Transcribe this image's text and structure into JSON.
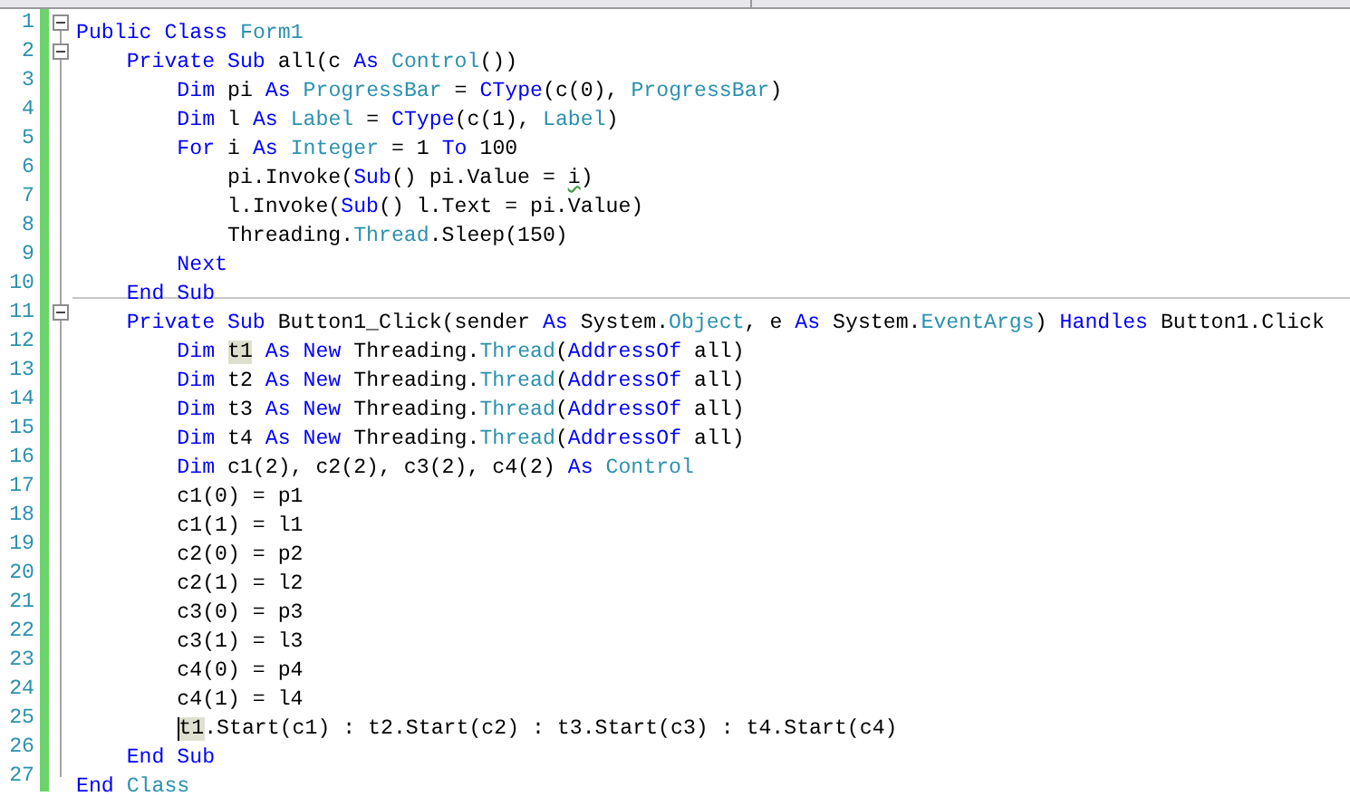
{
  "lines": [
    {
      "number": "1",
      "fold_toggle": {
        "expanded": true
      },
      "tokens": [
        {
          "kind": "keyword",
          "text": "Public"
        },
        {
          "kind": "keyword",
          "text": " Class"
        },
        {
          "kind": "type",
          "text": " Form1"
        }
      ]
    },
    {
      "number": "2",
      "fold_toggle": {
        "expanded": true
      },
      "tokens": [
        {
          "kind": "keyword",
          "text": "    Private Sub"
        },
        {
          "kind": "plain",
          "text": " all(c "
        },
        {
          "kind": "keyword",
          "text": "As"
        },
        {
          "kind": "type",
          "text": " Control"
        },
        {
          "kind": "plain",
          "text": "())"
        }
      ]
    },
    {
      "number": "3",
      "tokens": [
        {
          "kind": "keyword",
          "text": "        Dim"
        },
        {
          "kind": "plain",
          "text": " pi "
        },
        {
          "kind": "keyword",
          "text": "As"
        },
        {
          "kind": "type",
          "text": " ProgressBar"
        },
        {
          "kind": "plain",
          "text": " = "
        },
        {
          "kind": "keyword",
          "text": "CType"
        },
        {
          "kind": "plain",
          "text": "(c(0), "
        },
        {
          "kind": "type",
          "text": "ProgressBar"
        },
        {
          "kind": "plain",
          "text": ")"
        }
      ]
    },
    {
      "number": "4",
      "tokens": [
        {
          "kind": "keyword",
          "text": "        Dim"
        },
        {
          "kind": "plain",
          "text": " l "
        },
        {
          "kind": "keyword",
          "text": "As"
        },
        {
          "kind": "type",
          "text": " Label"
        },
        {
          "kind": "plain",
          "text": " = "
        },
        {
          "kind": "keyword",
          "text": "CType"
        },
        {
          "kind": "plain",
          "text": "(c(1), "
        },
        {
          "kind": "type",
          "text": "Label"
        },
        {
          "kind": "plain",
          "text": ")"
        }
      ]
    },
    {
      "number": "5",
      "tokens": [
        {
          "kind": "keyword",
          "text": "        For"
        },
        {
          "kind": "plain",
          "text": " i "
        },
        {
          "kind": "keyword",
          "text": "As"
        },
        {
          "kind": "type",
          "text": " Integer"
        },
        {
          "kind": "plain",
          "text": " = 1 "
        },
        {
          "kind": "keyword",
          "text": "To"
        },
        {
          "kind": "plain",
          "text": " 100"
        }
      ]
    },
    {
      "number": "6",
      "tokens": [
        {
          "kind": "plain",
          "text": "            pi.Invoke("
        },
        {
          "kind": "keyword",
          "text": "Sub"
        },
        {
          "kind": "plain",
          "text": "() pi.Value = "
        },
        {
          "kind": "warning",
          "text": "i"
        },
        {
          "kind": "plain",
          "text": ")"
        }
      ]
    },
    {
      "number": "7",
      "tokens": [
        {
          "kind": "plain",
          "text": "            l.Invoke("
        },
        {
          "kind": "keyword",
          "text": "Sub"
        },
        {
          "kind": "plain",
          "text": "() l.Text = pi.Value)"
        }
      ]
    },
    {
      "number": "8",
      "tokens": [
        {
          "kind": "plain",
          "text": "            Threading."
        },
        {
          "kind": "type",
          "text": "Thread"
        },
        {
          "kind": "plain",
          "text": ".Sleep(150)"
        }
      ]
    },
    {
      "number": "9",
      "tokens": [
        {
          "kind": "keyword",
          "text": "        Next"
        }
      ]
    },
    {
      "number": "10",
      "separator": true,
      "tokens": [
        {
          "kind": "keyword",
          "text": "    End Sub"
        }
      ]
    },
    {
      "number": "11",
      "fold_toggle": {
        "expanded": true
      },
      "tokens": [
        {
          "kind": "keyword",
          "text": "    Private Sub"
        },
        {
          "kind": "plain",
          "text": " Button1_Click(sender "
        },
        {
          "kind": "keyword",
          "text": "As"
        },
        {
          "kind": "plain",
          "text": " System."
        },
        {
          "kind": "type",
          "text": "Object"
        },
        {
          "kind": "plain",
          "text": ", e "
        },
        {
          "kind": "keyword",
          "text": "As"
        },
        {
          "kind": "plain",
          "text": " System."
        },
        {
          "kind": "type",
          "text": "EventArgs"
        },
        {
          "kind": "plain",
          "text": ") "
        },
        {
          "kind": "keyword",
          "text": "Handles"
        },
        {
          "kind": "plain",
          "text": " Button1.Click"
        }
      ]
    },
    {
      "number": "12",
      "tokens": [
        {
          "kind": "keyword",
          "text": "        Dim "
        },
        {
          "kind": "highlight",
          "text": "t1"
        },
        {
          "kind": "keyword",
          "text": " As New"
        },
        {
          "kind": "plain",
          "text": " Threading."
        },
        {
          "kind": "type",
          "text": "Thread"
        },
        {
          "kind": "plain",
          "text": "("
        },
        {
          "kind": "keyword",
          "text": "AddressOf"
        },
        {
          "kind": "plain",
          "text": " all)"
        }
      ]
    },
    {
      "number": "13",
      "tokens": [
        {
          "kind": "keyword",
          "text": "        Dim"
        },
        {
          "kind": "plain",
          "text": " t2 "
        },
        {
          "kind": "keyword",
          "text": "As New"
        },
        {
          "kind": "plain",
          "text": " Threading."
        },
        {
          "kind": "type",
          "text": "Thread"
        },
        {
          "kind": "plain",
          "text": "("
        },
        {
          "kind": "keyword",
          "text": "AddressOf"
        },
        {
          "kind": "plain",
          "text": " all)"
        }
      ]
    },
    {
      "number": "14",
      "tokens": [
        {
          "kind": "keyword",
          "text": "        Dim"
        },
        {
          "kind": "plain",
          "text": " t3 "
        },
        {
          "kind": "keyword",
          "text": "As New"
        },
        {
          "kind": "plain",
          "text": " Threading."
        },
        {
          "kind": "type",
          "text": "Thread"
        },
        {
          "kind": "plain",
          "text": "("
        },
        {
          "kind": "keyword",
          "text": "AddressOf"
        },
        {
          "kind": "plain",
          "text": " all)"
        }
      ]
    },
    {
      "number": "15",
      "tokens": [
        {
          "kind": "keyword",
          "text": "        Dim"
        },
        {
          "kind": "plain",
          "text": " t4 "
        },
        {
          "kind": "keyword",
          "text": "As New"
        },
        {
          "kind": "plain",
          "text": " Threading."
        },
        {
          "kind": "type",
          "text": "Thread"
        },
        {
          "kind": "plain",
          "text": "("
        },
        {
          "kind": "keyword",
          "text": "AddressOf"
        },
        {
          "kind": "plain",
          "text": " all)"
        }
      ]
    },
    {
      "number": "16",
      "tokens": [
        {
          "kind": "keyword",
          "text": "        Dim"
        },
        {
          "kind": "plain",
          "text": " c1(2), c2(2), c3(2), c4(2) "
        },
        {
          "kind": "keyword",
          "text": "As"
        },
        {
          "kind": "type",
          "text": " Control"
        }
      ]
    },
    {
      "number": "17",
      "tokens": [
        {
          "kind": "plain",
          "text": "        c1(0) = p1"
        }
      ]
    },
    {
      "number": "18",
      "tokens": [
        {
          "kind": "plain",
          "text": "        c1(1) = l1"
        }
      ]
    },
    {
      "number": "19",
      "tokens": [
        {
          "kind": "plain",
          "text": "        c2(0) = p2"
        }
      ]
    },
    {
      "number": "20",
      "tokens": [
        {
          "kind": "plain",
          "text": "        c2(1) = l2"
        }
      ]
    },
    {
      "number": "21",
      "tokens": [
        {
          "kind": "plain",
          "text": "        c3(0) = p3"
        }
      ]
    },
    {
      "number": "22",
      "tokens": [
        {
          "kind": "plain",
          "text": "        c3(1) = l3"
        }
      ]
    },
    {
      "number": "23",
      "tokens": [
        {
          "kind": "plain",
          "text": "        c4(0) = p4"
        }
      ]
    },
    {
      "number": "24",
      "tokens": [
        {
          "kind": "plain",
          "text": "        c4(1) = l4"
        }
      ]
    },
    {
      "number": "25",
      "caret": true,
      "tokens": [
        {
          "kind": "highlight",
          "text": "        t1"
        },
        {
          "kind": "plain",
          "text": ".Start(c1) : t2.Start(c2) : t3.Start(c3) : t4.Start(c4)"
        }
      ]
    },
    {
      "number": "26",
      "tokens": [
        {
          "kind": "keyword",
          "text": "    End Sub"
        }
      ]
    },
    {
      "number": "27",
      "tokens": [
        {
          "kind": "keyword",
          "text": "End"
        },
        {
          "kind": "type",
          "text": " Class"
        }
      ]
    }
  ]
}
